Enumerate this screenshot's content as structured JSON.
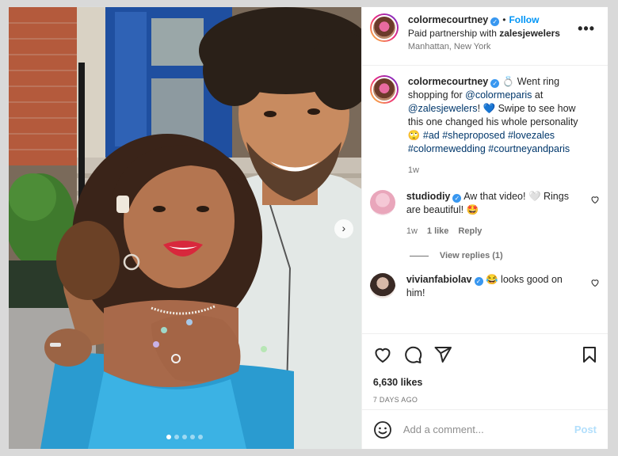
{
  "header": {
    "username": "colormecourtney",
    "follow_label": "Follow",
    "partnership_prefix": "Paid partnership with",
    "partner": "zalesjewelers",
    "location": "Manhattan, New York",
    "more_label": "•••"
  },
  "caption": {
    "username": "colormecourtney",
    "text_1": "💍 Went ring shopping",
    "text_2": "for",
    "mention_1": "@colormeparis",
    "text_3": "at",
    "mention_2": "@zalesjewelers",
    "text_4": "!",
    "text_5": "💙 Swipe to see how this one changed his whole personality 🙄",
    "tag_1": "#ad",
    "tag_2": "#sheproposed",
    "tag_3": "#lovezales",
    "tag_4": "#colormewedding",
    "tag_5": "#courtneyandparis",
    "time": "1w"
  },
  "comments": [
    {
      "username": "studiodiy",
      "text": "Aw that video! 🤍 Rings are beautiful! 🤩",
      "time": "1w",
      "likes": "1 like",
      "reply": "Reply"
    },
    {
      "username": "vivianfabiolav",
      "text": "😂 looks good on him!"
    }
  ],
  "view_replies": "View replies (1)",
  "likes": "6,630 likes",
  "posted_ago": "7 DAYS AGO",
  "comment_input": {
    "placeholder": "Add a comment..."
  },
  "post_label": "Post",
  "carousel": {
    "next": "›",
    "slides": 5,
    "active": 1
  },
  "icons": {
    "like": "heart-icon",
    "comment": "comment-icon",
    "share": "share-icon",
    "save": "bookmark-icon",
    "emoji": "emoji-icon"
  },
  "colors": {
    "accent": "#0095f6",
    "verified": "#3897f0",
    "post_disabled": "#b2dffc"
  }
}
